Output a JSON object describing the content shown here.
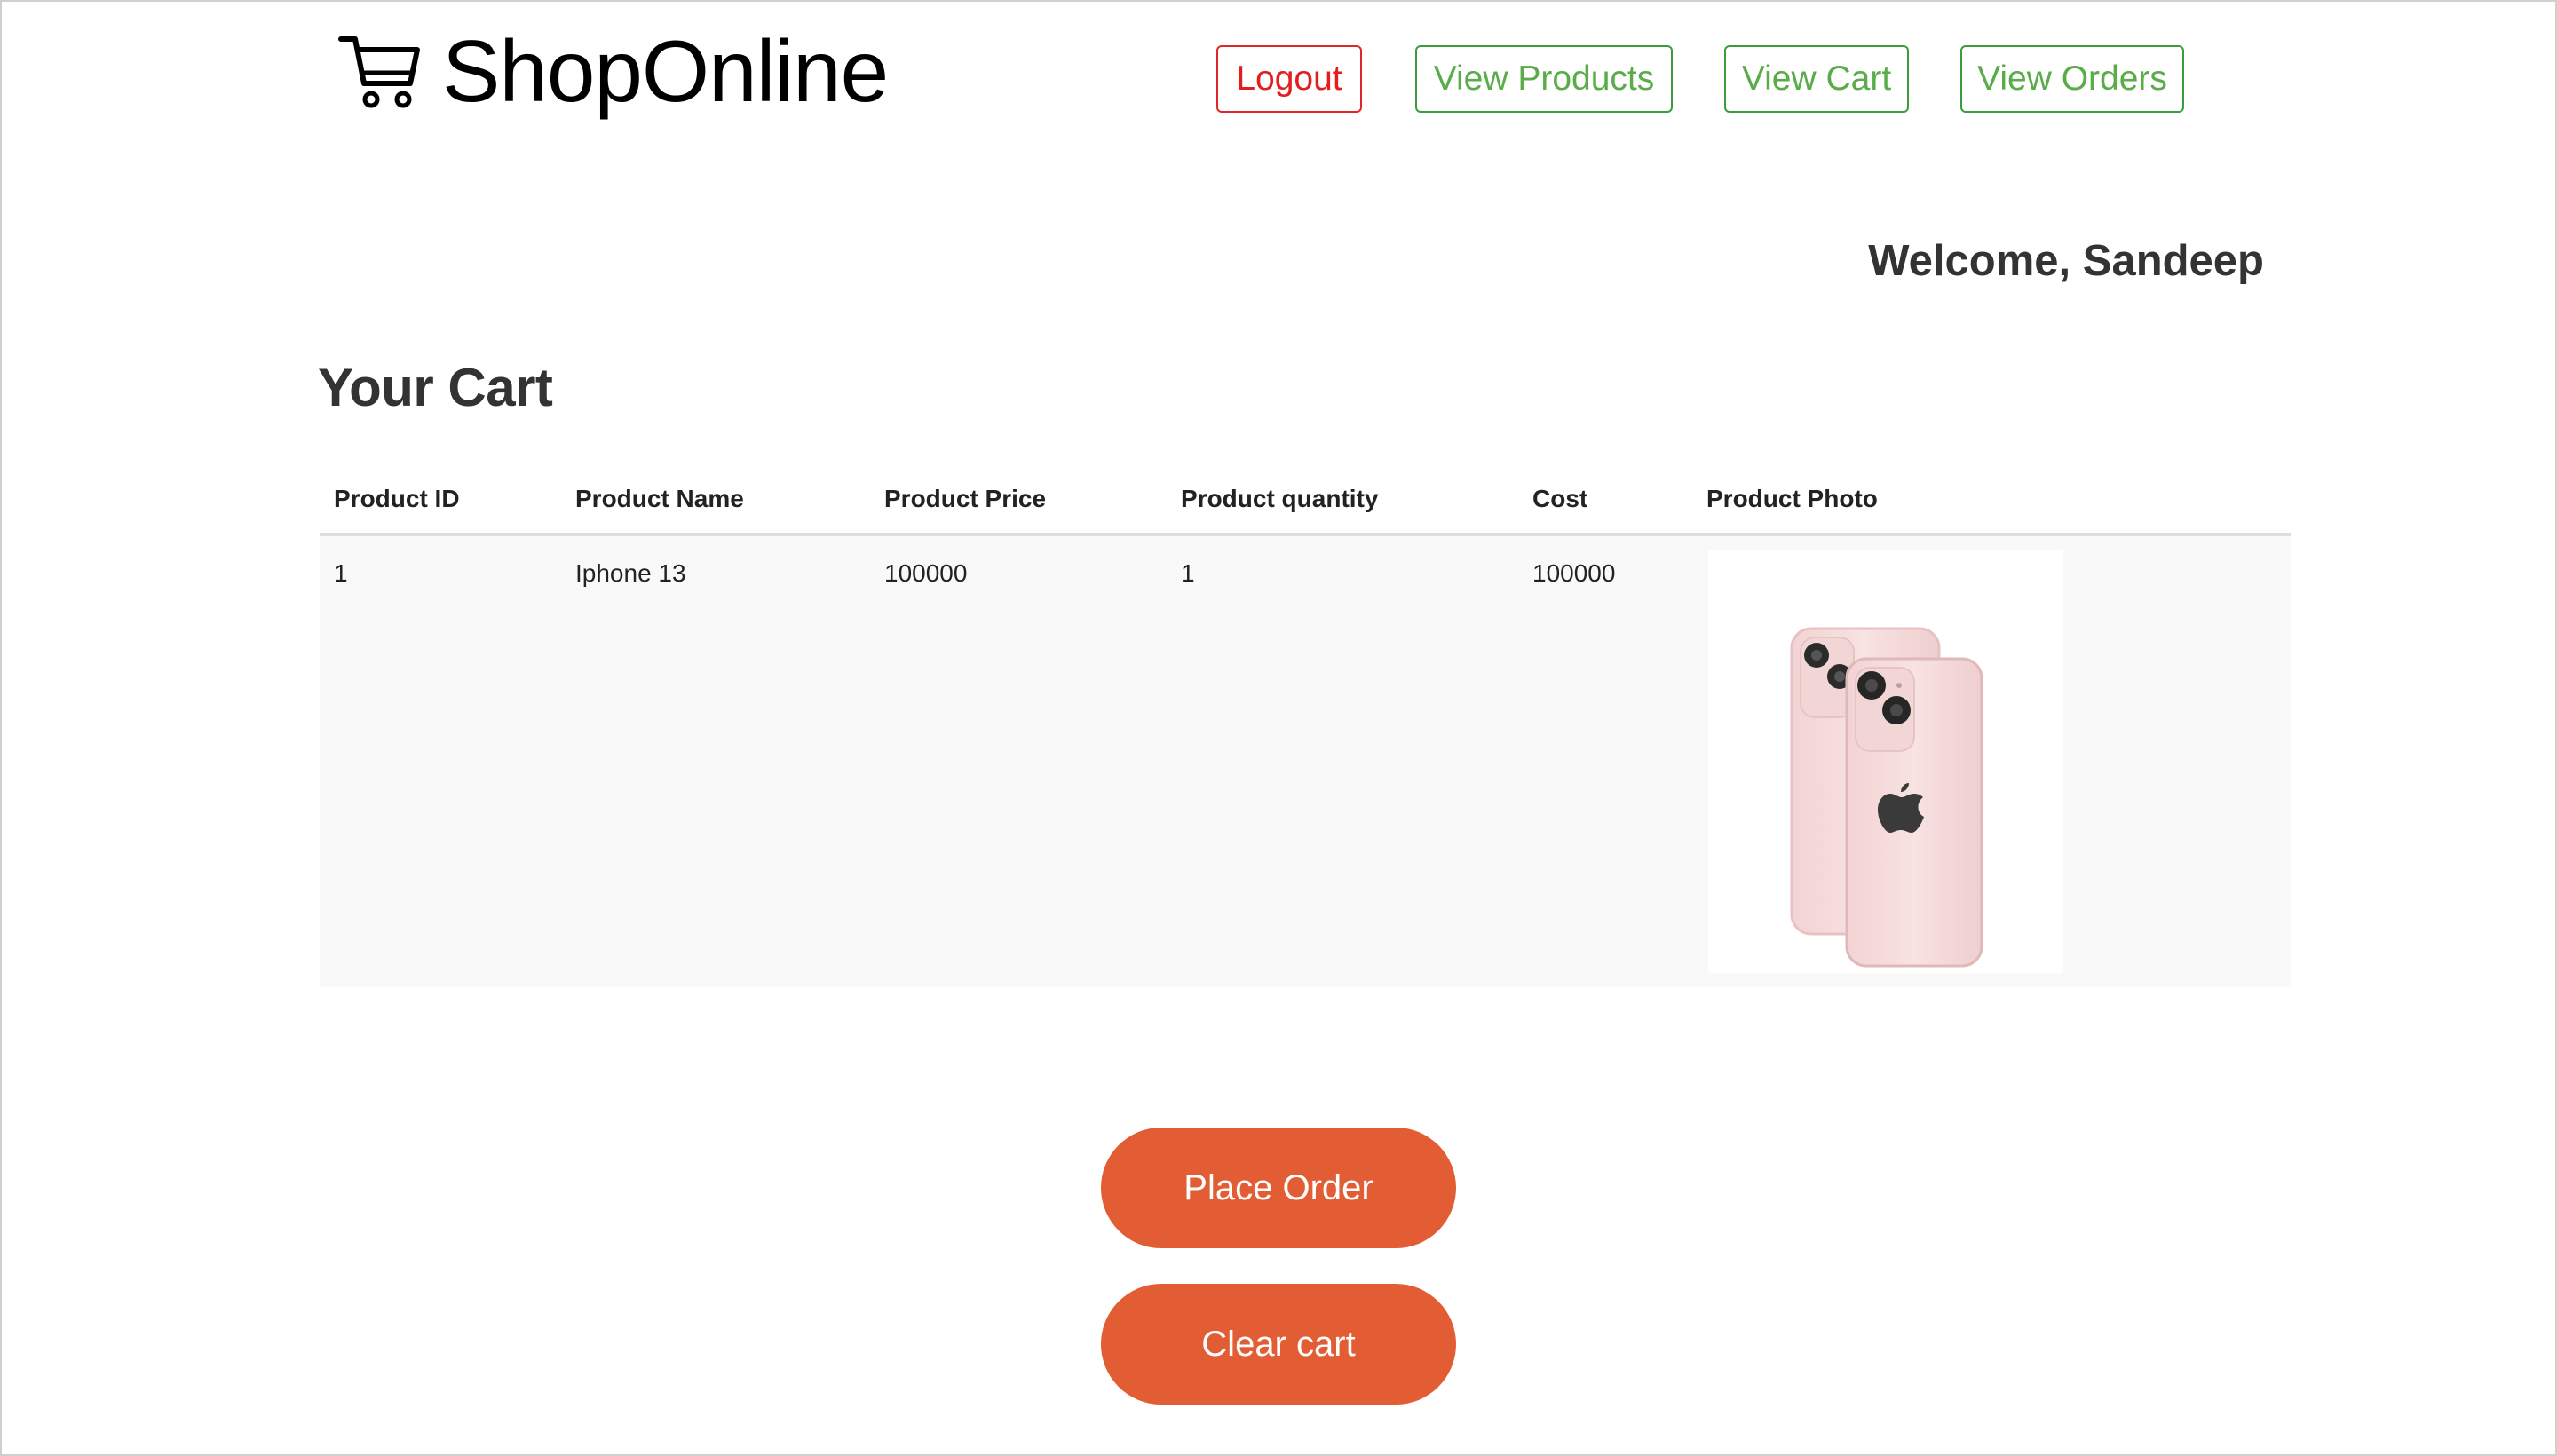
{
  "brand": {
    "name": "ShopOnline",
    "icon": "shopping-cart-icon"
  },
  "nav": {
    "logout": "Logout",
    "view_products": "View Products",
    "view_cart": "View Cart",
    "view_orders": "View Orders"
  },
  "welcome": "Welcome, Sandeep",
  "page_title": "Your Cart",
  "table": {
    "headers": [
      "Product ID",
      "Product Name",
      "Product Price",
      "Product quantity",
      "Cost",
      "Product Photo"
    ],
    "rows": [
      {
        "id": "1",
        "name": "Iphone 13",
        "price": "100000",
        "quantity": "1",
        "cost": "100000",
        "photo": "iphone-13-pink-photo"
      }
    ]
  },
  "actions": {
    "place_order": "Place Order",
    "clear_cart": "Clear cart"
  },
  "colors": {
    "nav_green": "#5aac4a",
    "logout_red": "#e21e1e",
    "action_orange": "#e25c34",
    "phone_pink": "#f6dcdc"
  }
}
